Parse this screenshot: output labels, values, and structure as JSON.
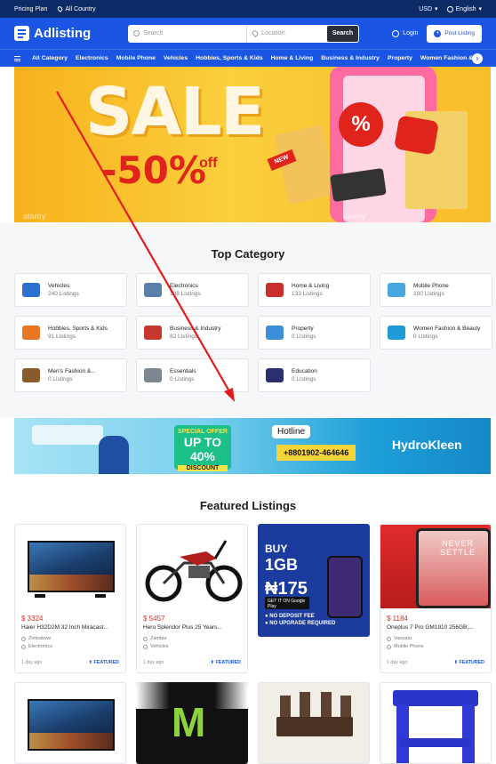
{
  "topbar": {
    "pricing_plan": "Pricing Plan",
    "location": "All Country",
    "currency": "USD",
    "language": "English"
  },
  "header": {
    "logo": "Adlisting",
    "search_placeholder": "Search",
    "location_placeholder": "Location",
    "search_button": "Search",
    "login": "Login",
    "post_listing": "Post Listing"
  },
  "catnav": {
    "items": [
      "All Category",
      "Electronics",
      "Mobile Phone",
      "Vehicles",
      "Hobbies, Sports & Kids",
      "Home & Living",
      "Business & Industry",
      "Property",
      "Women Fashion & B"
    ]
  },
  "hero": {
    "headline": "SALE",
    "discount": "-50%",
    "off": "off",
    "tag": "NEW",
    "watermark": "alamy"
  },
  "categories": {
    "title": "Top Category",
    "items": [
      {
        "name": "Vehicles",
        "count": "240 Listings",
        "color": "#2d6fd1"
      },
      {
        "name": "Electronics",
        "count": "108 Listings",
        "color": "#5a7fa8"
      },
      {
        "name": "Home & Living",
        "count": "133 Listings",
        "color": "#c9302c"
      },
      {
        "name": "Mobile Phone",
        "count": "100 Listings",
        "color": "#48a6e0"
      },
      {
        "name": "Hobbies, Sports & Kids",
        "count": "91 Listings",
        "color": "#e87722"
      },
      {
        "name": "Business & Industry",
        "count": "82 Listings",
        "color": "#c8372d"
      },
      {
        "name": "Property",
        "count": "0 Listings",
        "color": "#3b8ed8"
      },
      {
        "name": "Women Fashion & Beauty",
        "count": "0 Listings",
        "color": "#1e9ad6"
      },
      {
        "name": "Men's Fashion &...",
        "count": "0 Listings",
        "color": "#8a5a2b"
      },
      {
        "name": "Essentials",
        "count": "0 Listings",
        "color": "#7d8791"
      },
      {
        "name": "Education",
        "count": "0 Listings",
        "color": "#2b2f6e"
      }
    ]
  },
  "banner": {
    "special_offer": "SPECIAL OFFER",
    "up_to": "UP TO 40%",
    "discount_label": "DISCOUNT",
    "hotline_label": "Hotline",
    "hotline_number": "+8801902-464646",
    "brand": "HydroKleen"
  },
  "featured": {
    "title": "Featured Listings",
    "listings": [
      {
        "price": "$ 3324",
        "title": "Haier H32D2M 32 Inch Miracast...",
        "location": "Zimbabwe",
        "category": "Electronics",
        "age": "1 day ago",
        "badge": "FEATURED"
      },
      {
        "price": "$ 5457",
        "title": "Hero Splendor Plus 25 Years...",
        "location": "Zambia",
        "category": "Vehicles",
        "age": "1 day ago",
        "badge": "FEATURED"
      },
      {
        "price": "",
        "title": "",
        "location": "",
        "category": "",
        "age": "",
        "badge": "",
        "promo": {
          "buy": "BUY",
          "amount": "1GB",
          "at": "@",
          "price": "₦175",
          "store": "GET IT ON Google Play",
          "line1": "● NO DEPOSIT FEE",
          "line2": "● NO UPGRADE REQUIRED"
        }
      },
      {
        "price": "$ 1184",
        "title": "Oneplus 7 Pro GM1910 256GB,...",
        "location": "Vanuatu",
        "category": "Mobile Phone",
        "age": "1 day ago",
        "badge": "FEATURED",
        "screen_text": "NEVER SETTLE"
      }
    ]
  }
}
